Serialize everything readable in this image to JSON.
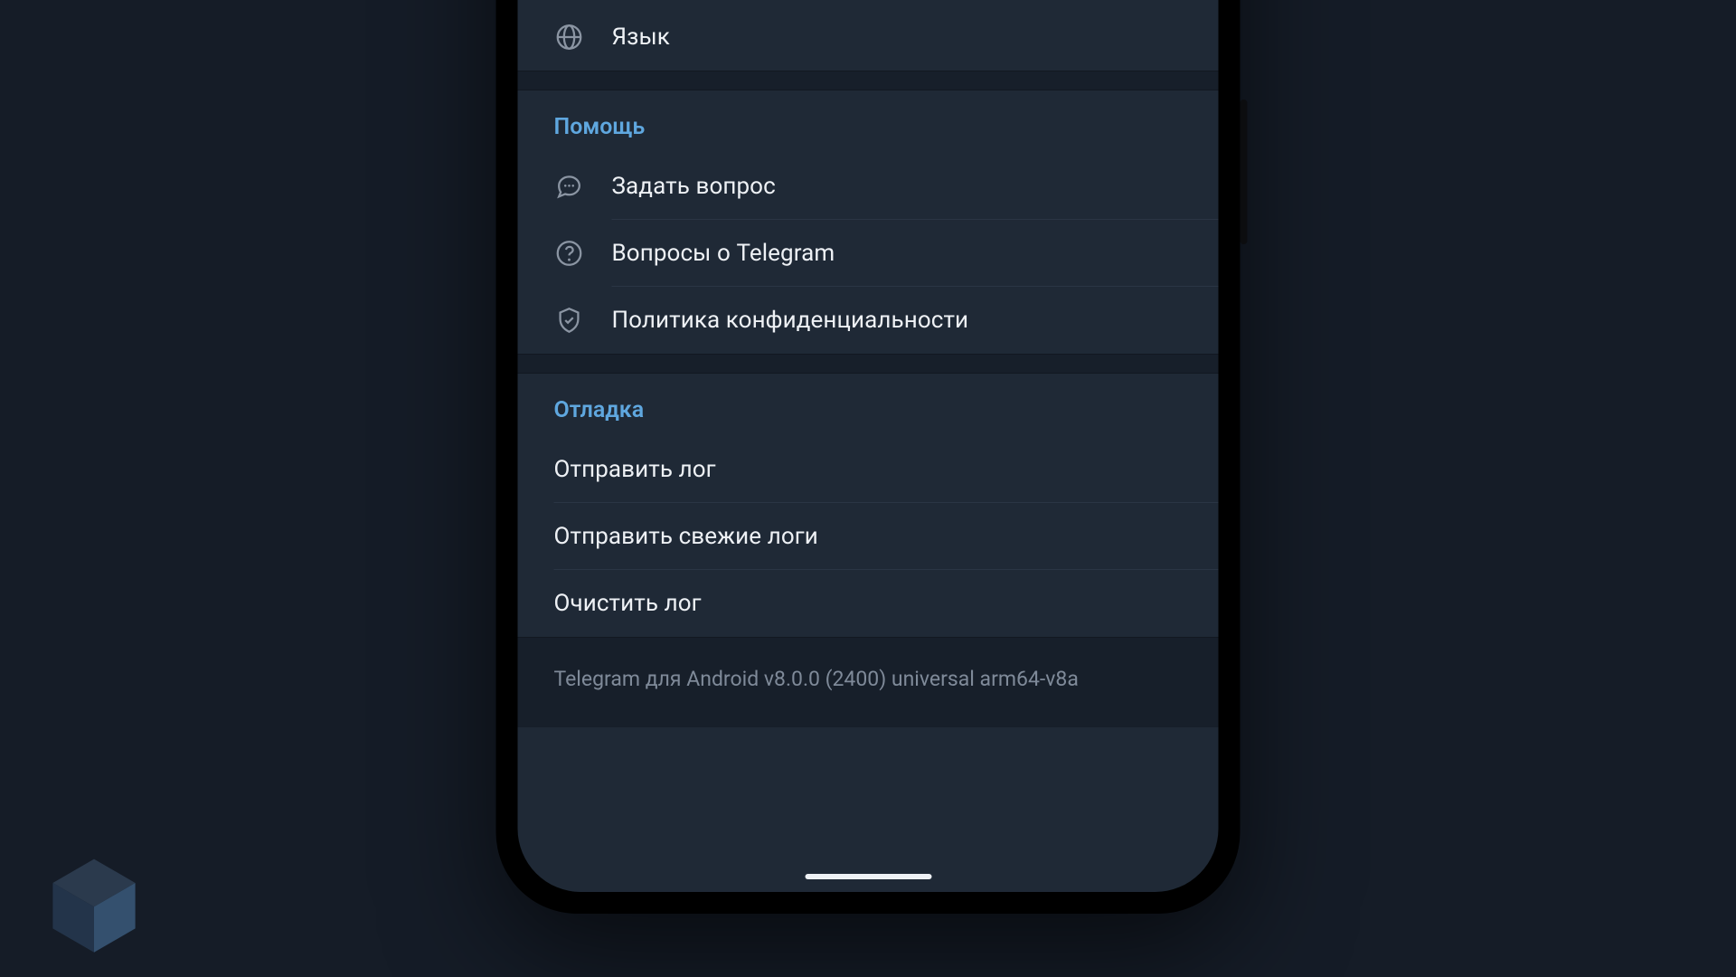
{
  "settings": {
    "language_row": {
      "label": "Язык"
    },
    "help": {
      "title": "Помощь",
      "items": [
        {
          "label": "Задать вопрос"
        },
        {
          "label": "Вопросы о Telegram"
        },
        {
          "label": "Политика конфиденциальности"
        }
      ]
    },
    "debug": {
      "title": "Отладка",
      "items": [
        {
          "label": "Отправить лог"
        },
        {
          "label": "Отправить свежие логи"
        },
        {
          "label": "Очистить лог"
        }
      ]
    },
    "version_line": "Telegram для Android v8.0.0 (2400) universal arm64-v8a"
  }
}
